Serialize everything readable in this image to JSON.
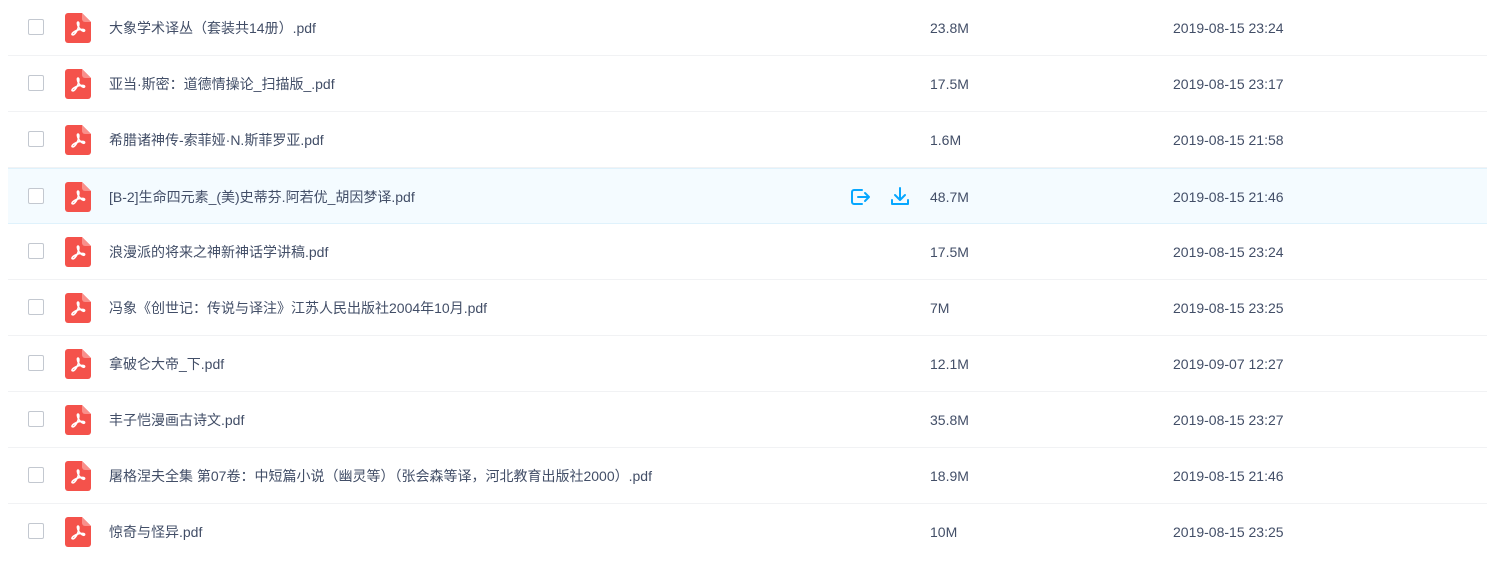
{
  "colors": {
    "pdf_icon": "#f4524b",
    "action_icon": "#06a7ff",
    "hover_row": "#f4fbff",
    "text": "#424e67"
  },
  "files": [
    {
      "name": "大象学术译丛（套装共14册）.pdf",
      "size": "23.8M",
      "date": "2019-08-15 23:24"
    },
    {
      "name": "亚当·斯密：道德情操论_扫描版_.pdf",
      "size": "17.5M",
      "date": "2019-08-15 23:17"
    },
    {
      "name": "希腊诸神传-索菲娅·N.斯菲罗亚.pdf",
      "size": "1.6M",
      "date": "2019-08-15 21:58"
    },
    {
      "name": "[B-2]生命四元素_(美)史蒂芬.阿若优_胡因梦译.pdf",
      "size": "48.7M",
      "date": "2019-08-15 21:46",
      "hovered": true
    },
    {
      "name": "浪漫派的将来之神新神话学讲稿.pdf",
      "size": "17.5M",
      "date": "2019-08-15 23:24"
    },
    {
      "name": "冯象《创世记：传说与译注》江苏人民出版社2004年10月.pdf",
      "size": "7M",
      "date": "2019-08-15 23:25"
    },
    {
      "name": "拿破仑大帝_下.pdf",
      "size": "12.1M",
      "date": "2019-09-07 12:27"
    },
    {
      "name": "丰子恺漫画古诗文.pdf",
      "size": "35.8M",
      "date": "2019-08-15 23:27"
    },
    {
      "name": "屠格涅夫全集 第07卷：中短篇小说（幽灵等）（张会森等译，河北教育出版社2000）.pdf",
      "size": "18.9M",
      "date": "2019-08-15 21:46"
    },
    {
      "name": "惊奇与怪异.pdf",
      "size": "10M",
      "date": "2019-08-15 23:25"
    }
  ],
  "icons": {
    "file_type": "pdf-file-icon",
    "share": "share-icon",
    "download": "download-icon"
  }
}
